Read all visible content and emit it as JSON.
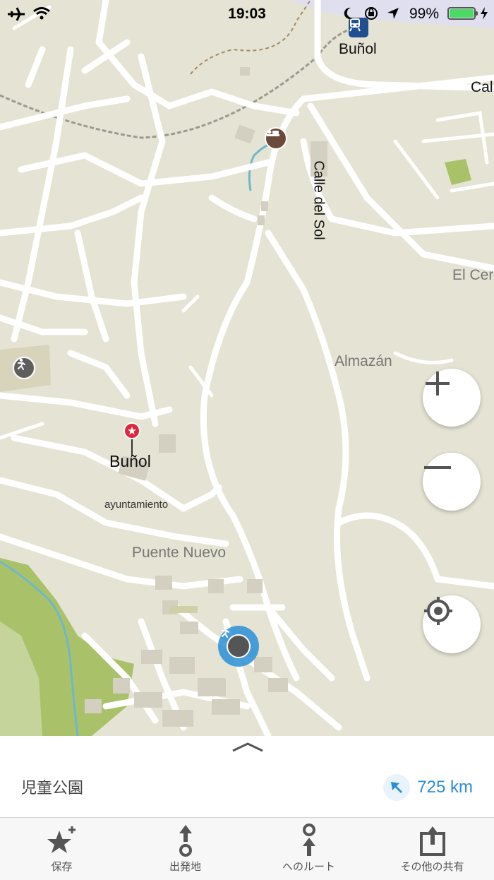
{
  "status": {
    "time": "19:03",
    "battery": "99%"
  },
  "map": {
    "labels": {
      "bunol_station": "Buñol",
      "cal": "Cal",
      "calle_del_sol": "Calle del Sol",
      "el_cer": "El Cer",
      "almazan": "Almazán",
      "bunol_town": "Buñol",
      "ayuntamiento": "ayuntamiento",
      "puente_nuevo": "Puente Nuevo"
    },
    "colors": {
      "land": "#e5e3d3",
      "road": "#ffffff",
      "park": "#a9c26a",
      "water": "#6fb7c9",
      "accent": "#2a8fd6",
      "pin": "#e0263a"
    }
  },
  "controls": {
    "zoom_in": "zoom-in-icon",
    "zoom_out": "zoom-out-icon",
    "locate": "locate-icon"
  },
  "sheet": {
    "place_name": "児童公園",
    "distance": "725 km"
  },
  "tabbar": {
    "save": "保存",
    "from": "出発地",
    "route_to": "へのルート",
    "share": "その他の共有"
  }
}
